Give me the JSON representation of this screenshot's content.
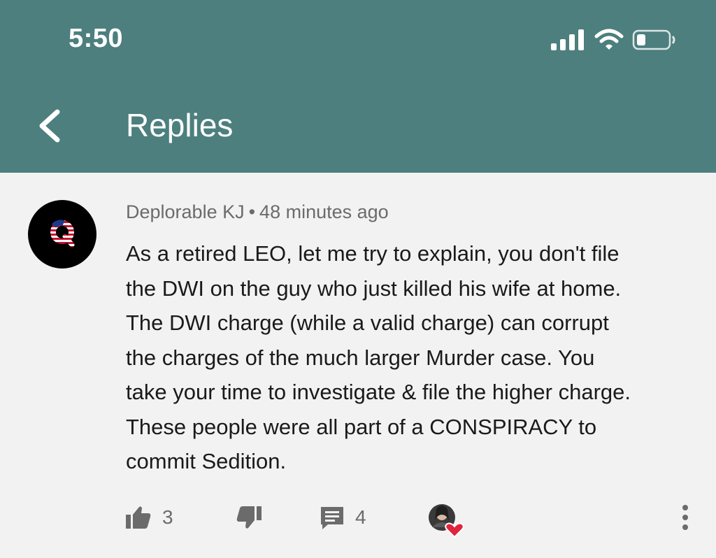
{
  "status_bar": {
    "time": "5:50",
    "icons": [
      "signal-icon",
      "wifi-icon",
      "battery-icon"
    ]
  },
  "header": {
    "title": "Replies",
    "back_icon": "chevron-left-icon",
    "bg_color": "#4c7f7e"
  },
  "comment": {
    "author": "Deplorable KJ",
    "separator": "•",
    "timestamp": "48 minutes ago",
    "avatar_letter": "Q",
    "lines": [
      "As a retired LEO, let me try to explain,  you don't file",
      "the DWI on the guy who just killed his wife at home.",
      "The DWI charge (while a valid charge) can corrupt",
      "the charges of the much larger Murder case. You",
      "take your time to investigate & file the higher charge.",
      "These people were all part of a CONSPIRACY to",
      "commit Sedition."
    ]
  },
  "actions": {
    "like_count": "3",
    "reply_count": "4",
    "icons": [
      "thumbs-up-icon",
      "thumbs-down-icon",
      "reply-comment-icon",
      "creator-heart-icon",
      "more-vertical-icon"
    ]
  }
}
